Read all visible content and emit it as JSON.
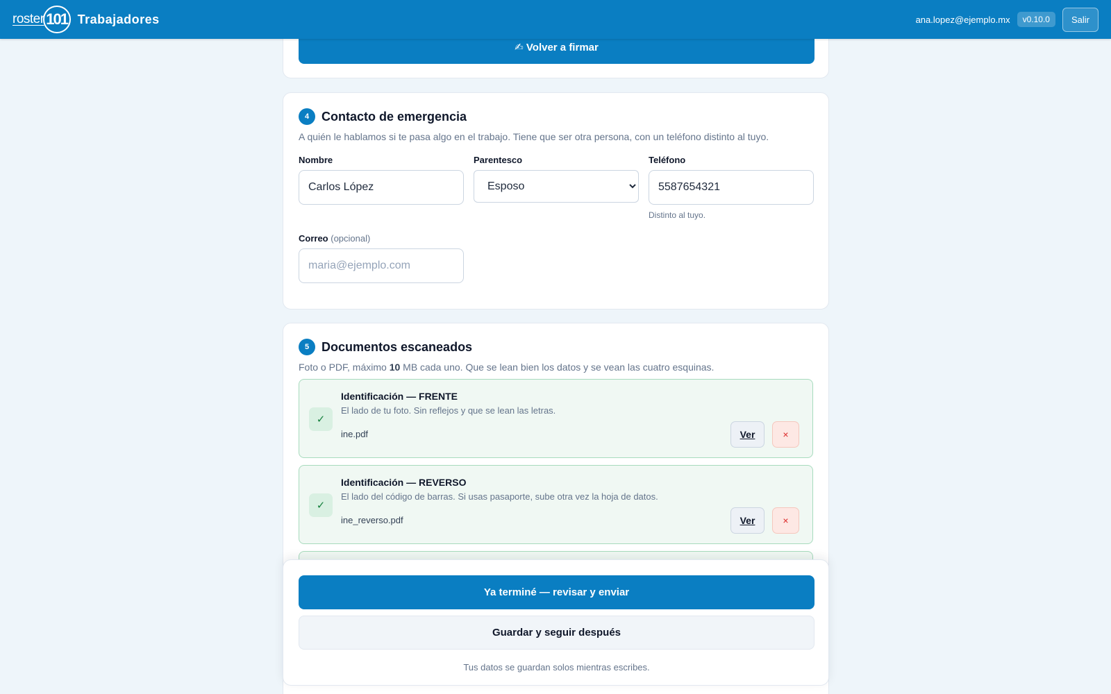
{
  "header": {
    "logo_text": "roster",
    "logo_mark": "101",
    "title": "Trabajadores",
    "user_email": "ana.lopez@ejemplo.mx",
    "version": "v0.10.0",
    "logout_label": "Salir"
  },
  "signature": {
    "resign_label": "✍ Volver a firmar"
  },
  "emergency": {
    "step": "4",
    "title": "Contacto de emergencia",
    "description": "A quién le hablamos si te pasa algo en el trabajo. Tiene que ser otra persona, con un teléfono distinto al tuyo.",
    "name_label": "Nombre",
    "name_value": "Carlos López",
    "relationship_label": "Parentesco",
    "relationship_value": "Esposo",
    "phone_label": "Teléfono",
    "phone_value": "5587654321",
    "phone_hint": "Distinto al tuyo.",
    "email_label": "Correo",
    "email_optional": "(opcional)",
    "email_placeholder": "maria@ejemplo.com"
  },
  "documents": {
    "step": "5",
    "title": "Documentos escaneados",
    "desc_before": "Foto o PDF, máximo ",
    "desc_bold": "10",
    "desc_after": " MB cada uno. Que se lean bien los datos y se vean las cuatro esquinas.",
    "items": [
      {
        "title": "Identificación — FRENTE",
        "description": "El lado de tu foto. Sin reflejos y que se lean las letras.",
        "file": "ine.pdf",
        "view_label": "Ver",
        "remove_label": "×"
      },
      {
        "title": "Identificación — REVERSO",
        "description": "El lado del código de barras. Si usas pasaporte, sube otra vez la hoja de datos.",
        "file": "ine_reverso.pdf",
        "view_label": "Ver",
        "remove_label": "×"
      }
    ]
  },
  "footer": {
    "submit_label": "Ya terminé — revisar y enviar",
    "save_label": "Guardar y seguir después",
    "autosave_note": "Tus datos se guardan solos mientras escribes."
  },
  "colors": {
    "primary": "#0a7ec2",
    "success_bg": "#f0f8f3",
    "danger": "#dc2626"
  }
}
